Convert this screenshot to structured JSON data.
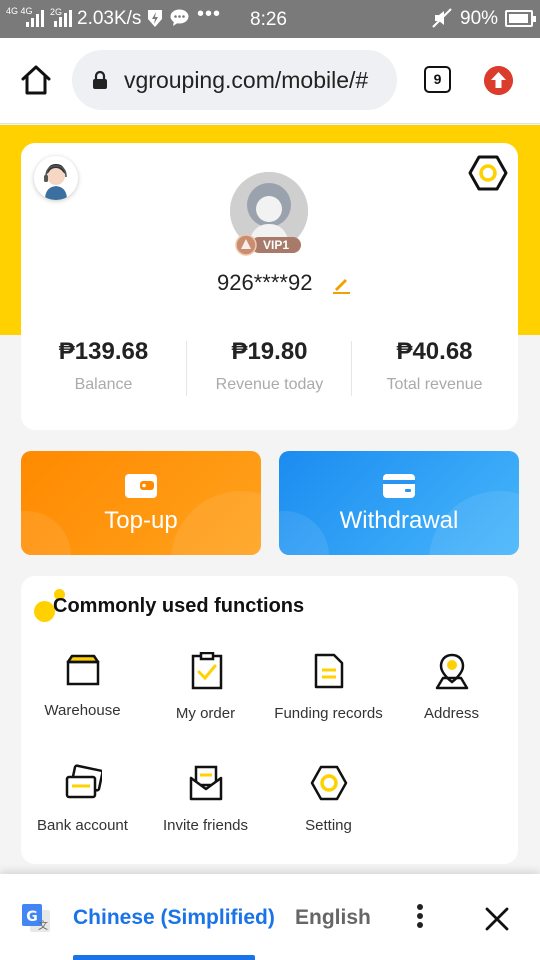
{
  "status_bar": {
    "network_top": "4G 4G",
    "network_type2": "2G",
    "speed": "2.03K/s",
    "time": "8:26",
    "battery": "90%",
    "icons": [
      "signal-icon",
      "flash-icon",
      "message-icon",
      "more-icon",
      "mute-icon",
      "battery-icon"
    ]
  },
  "browser": {
    "url": "vgrouping.com/mobile/#",
    "tab_count": "9",
    "icons": [
      "home-icon",
      "lock-icon",
      "tabs-icon",
      "update-icon"
    ]
  },
  "profile": {
    "vip_level": "VIP1",
    "username": "926****92",
    "stats": [
      {
        "value": "₱139.68",
        "label": "Balance"
      },
      {
        "value": "₱19.80",
        "label": "Revenue today"
      },
      {
        "value": "₱40.68",
        "label": "Total revenue"
      }
    ]
  },
  "actions": {
    "topup_label": "Top-up",
    "withdrawal_label": "Withdrawal"
  },
  "functions": {
    "title": "Commonly used functions",
    "items": [
      {
        "label": "Warehouse",
        "icon": "warehouse-icon"
      },
      {
        "label": "My order",
        "icon": "clipboard-check-icon"
      },
      {
        "label": "Funding records",
        "icon": "document-icon"
      },
      {
        "label": "Address",
        "icon": "location-icon"
      },
      {
        "label": "Bank account",
        "icon": "bank-card-icon"
      },
      {
        "label": "Invite friends",
        "icon": "envelope-icon"
      },
      {
        "label": "Setting",
        "icon": "hexagon-settings-icon"
      }
    ]
  },
  "translate_bar": {
    "source_lang": "Chinese (Simplified)",
    "target_lang": "English"
  },
  "colors": {
    "brand_yellow": "#ffd100",
    "topup_orange": "#ff8a00",
    "withdraw_blue": "#1b8cf0",
    "translate_blue": "#1a73e8"
  }
}
